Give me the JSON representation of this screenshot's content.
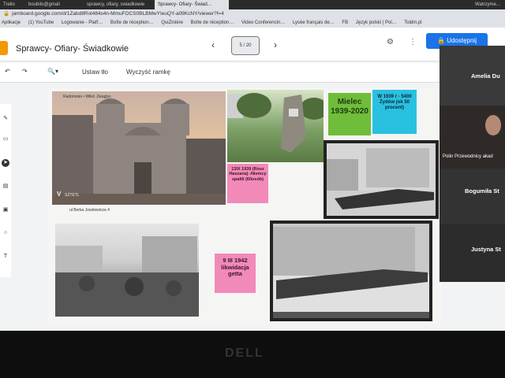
{
  "browser": {
    "tabs": [
      "Trello",
      "boubilo@gmail",
      "sprawcy, ofiary, swiadkowie",
      "Sprawcy- Ofiary- Świad…",
      "Watrzyme…"
    ],
    "url": "jamboard.google.com/d/1Zabd8Rol484s4n-MmuFOCS0BLBMwYIeuQY-a09KcNY/viewer?f=4",
    "bookmarks": [
      "Aplikacje",
      "(1) YouTube",
      "Logowanie - Platf…",
      "Boîte de réception…",
      "QuiZinière",
      "Boîte de réception…",
      "Video Conferencin…",
      "Lycée français de…",
      "FB",
      "Język polski | Pol…",
      "Toldm.pl"
    ]
  },
  "app": {
    "title": "Sprawcy- Ofiary- Świadkowie",
    "frame_counter": "5 / 20",
    "share_label": "Udostępnij",
    "toolbar": {
      "set_bg": "Ustaw tło",
      "clear_frame": "Wyczyść ramkę"
    }
  },
  "board": {
    "photo1_caption": "Radomsko • Wlkd. Zwaglys",
    "photo1_sub": "ul Berka Joselewicza 4",
    "photo1_mark": "V",
    "photo1_mark2": "SZTETL",
    "green_note": "Mielec 1939-2020",
    "cyan_note": "W 1939 r - 5400 Żydów (ok 50 procent)",
    "pink_note1": "13IX 1939 (Rosz Haszana) -Niemcy spalili (60osób)",
    "pink_note2": "9 III 1942 likwidacja getta"
  },
  "participants": [
    {
      "name": "Amelia Du"
    },
    {
      "name": "Polin Przewodnicy akad"
    },
    {
      "name": "Bogumiła St"
    },
    {
      "name": "Justyna St"
    }
  ],
  "monitor_brand": "DELL"
}
